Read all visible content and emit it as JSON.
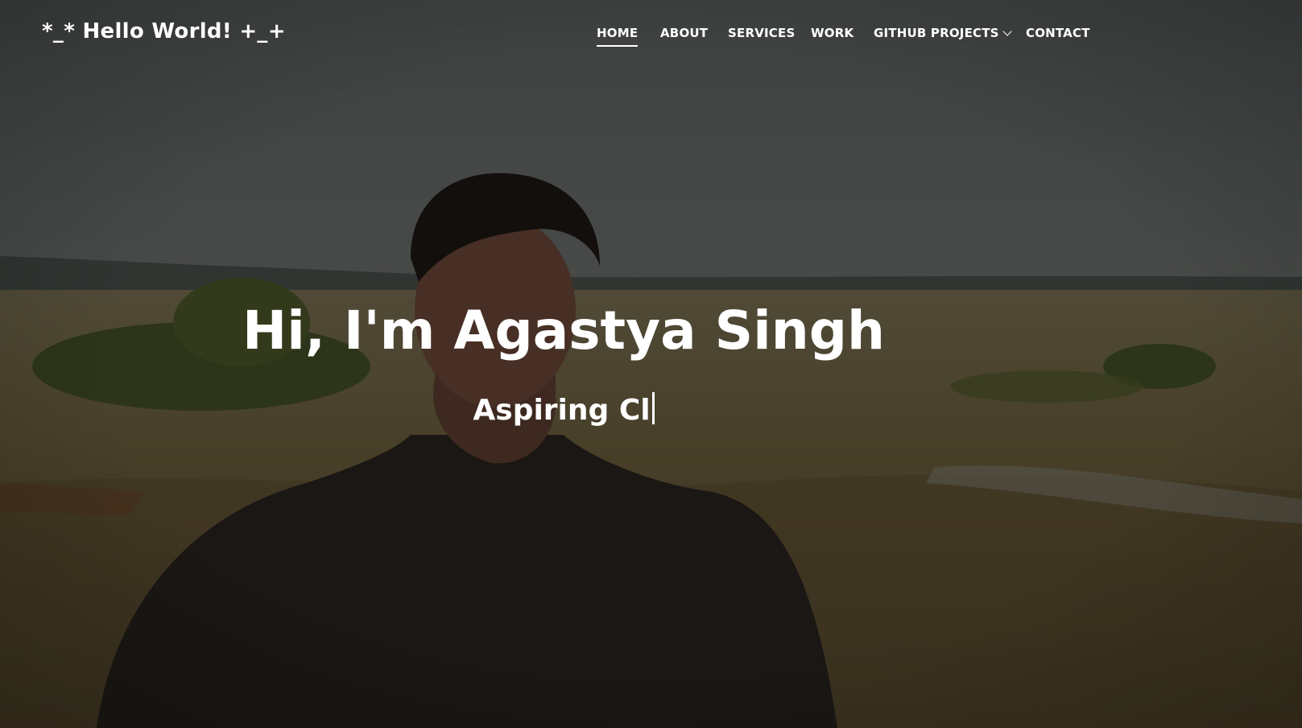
{
  "brand": {
    "text": "*_* Hello World! +_+"
  },
  "nav": {
    "items": [
      {
        "label": "HOME",
        "active": true
      },
      {
        "label": "ABOUT"
      },
      {
        "label": "SERVICES"
      },
      {
        "label": "WORK"
      },
      {
        "label": "GITHUB PROJECTS",
        "dropdown": true
      },
      {
        "label": "CONTACT"
      }
    ]
  },
  "hero": {
    "title": "Hi, I'm Agastya Singh",
    "subtitle": "Aspiring Cl",
    "background_image": "portrait-in-grassland-photo"
  },
  "icons": {
    "dropdown": "chevron-down-icon",
    "cursor": "text-caret"
  },
  "colors": {
    "text": "#ffffff",
    "overlay": "rgba(0,0,0,0.45)"
  }
}
